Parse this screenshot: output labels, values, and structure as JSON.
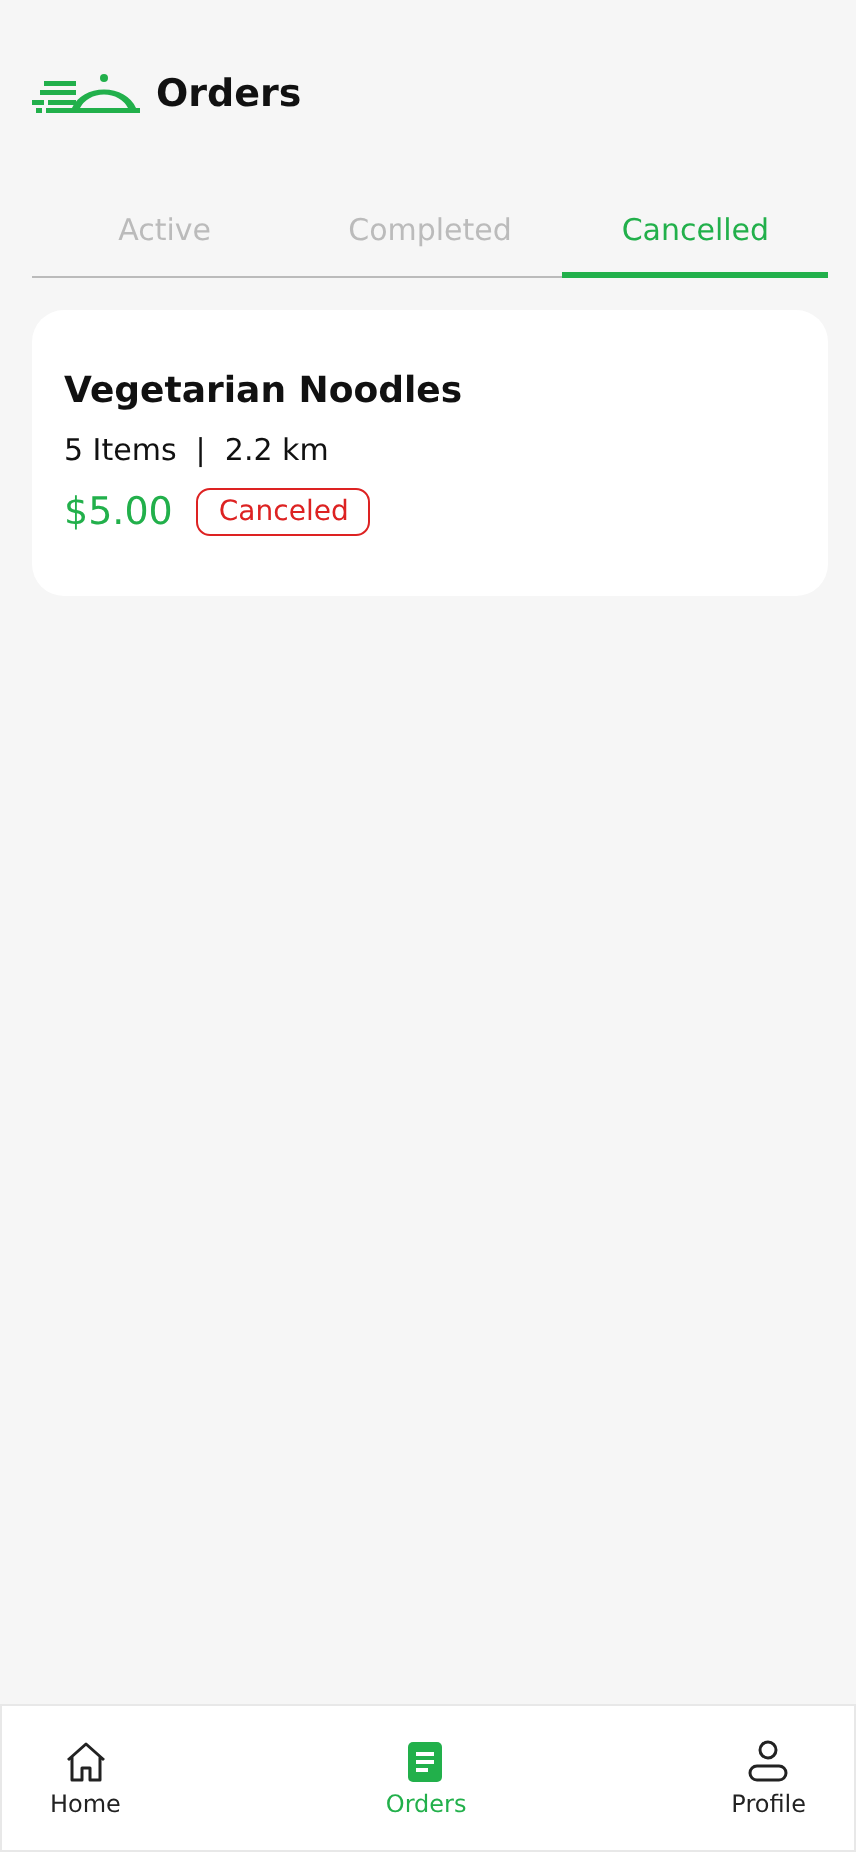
{
  "header": {
    "title": "Orders"
  },
  "tabs": [
    {
      "label": "Active",
      "selected": false
    },
    {
      "label": "Completed",
      "selected": false
    },
    {
      "label": "Cancelled",
      "selected": true
    }
  ],
  "orders": [
    {
      "name": "Vegetarian Noodles",
      "meta": "5 Items  |  2.2 km",
      "price": "$5.00",
      "status": "Canceled"
    }
  ],
  "nav": [
    {
      "label": "Home",
      "kind": "home",
      "selected": false
    },
    {
      "label": "Orders",
      "kind": "orders",
      "selected": true
    },
    {
      "label": "Profile",
      "kind": "profile",
      "selected": false
    }
  ]
}
